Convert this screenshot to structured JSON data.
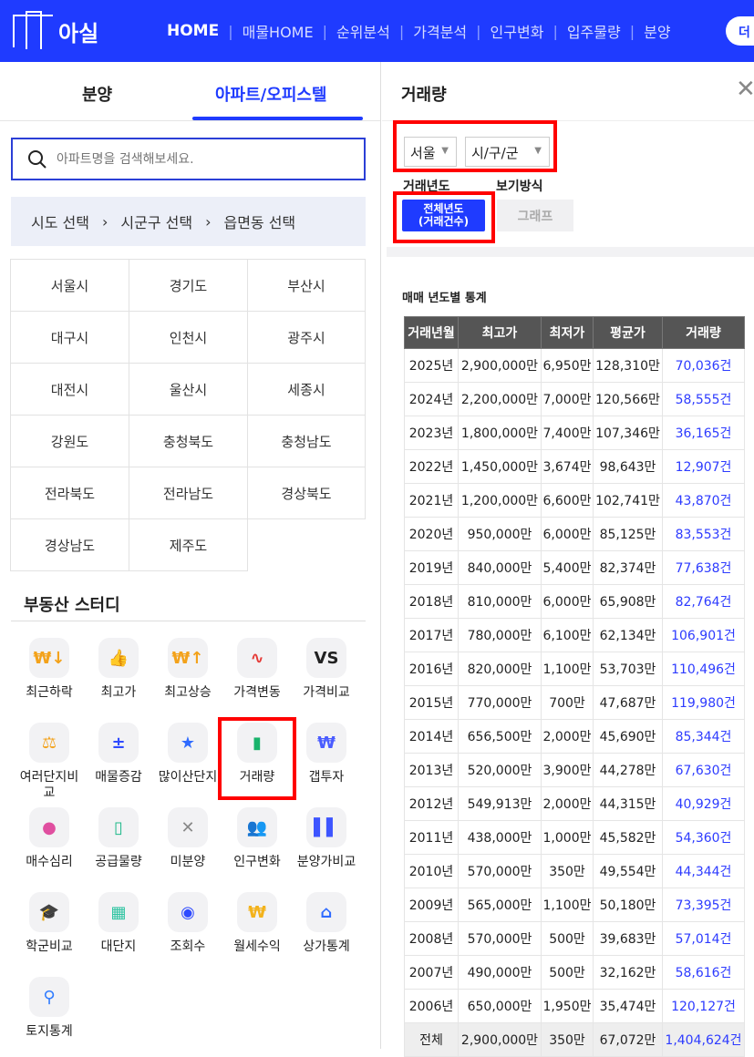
{
  "header": {
    "logo": "아실",
    "nav": [
      "HOME",
      "매물HOME",
      "순위분석",
      "가격분석",
      "인구변화",
      "입주물량",
      "분양"
    ],
    "more": "더"
  },
  "left": {
    "tabs": [
      "분양",
      "아파트/오피스텔"
    ],
    "search_placeholder": "아파트명을 검색해보세요.",
    "breadcrumb": [
      "시도 선택",
      "시군구 선택",
      "읍면동 선택"
    ],
    "regions": [
      "서울시",
      "경기도",
      "부산시",
      "대구시",
      "인천시",
      "광주시",
      "대전시",
      "울산시",
      "세종시",
      "강원도",
      "충청북도",
      "충청남도",
      "전라북도",
      "전라남도",
      "경상북도",
      "경상남도",
      "제주도"
    ],
    "study_title": "부동산 스터디",
    "study": [
      {
        "label": "최근하락",
        "icon": "price-down-icon",
        "glyph": "₩↓",
        "color": "#f3a21b"
      },
      {
        "label": "최고가",
        "icon": "thumbs-up-icon",
        "glyph": "👍",
        "color": "#3d6bff"
      },
      {
        "label": "최고상승",
        "icon": "price-up-icon",
        "glyph": "₩↑",
        "color": "#f3a21b"
      },
      {
        "label": "가격변동",
        "icon": "pulse-icon",
        "glyph": "∿",
        "color": "#e53935"
      },
      {
        "label": "가격비교",
        "icon": "vs-icon",
        "glyph": "VS",
        "color": "#222"
      },
      {
        "label": "여러단지비교",
        "icon": "scale-icon",
        "glyph": "⚖",
        "color": "#f3a21b"
      },
      {
        "label": "매물증감",
        "icon": "plus-minus-icon",
        "glyph": "±",
        "color": "#2f4bff"
      },
      {
        "label": "많이산단지",
        "icon": "map-pin-star-icon",
        "glyph": "★",
        "color": "#2f6bff"
      },
      {
        "label": "거래량",
        "icon": "bar-chart-icon",
        "glyph": "▮",
        "color": "#19b36b"
      },
      {
        "label": "갭투자",
        "icon": "money-bag-hand-icon",
        "glyph": "₩",
        "color": "#4a5cff"
      },
      {
        "label": "매수심리",
        "icon": "brain-icon",
        "glyph": "●",
        "color": "#e04fa0"
      },
      {
        "label": "공급물량",
        "icon": "building-hand-icon",
        "glyph": "▯",
        "color": "#1fb98a"
      },
      {
        "label": "미분양",
        "icon": "document-x-icon",
        "glyph": "✕",
        "color": "#888"
      },
      {
        "label": "인구변화",
        "icon": "people-icon",
        "glyph": "👥",
        "color": "#2f7bff"
      },
      {
        "label": "분양가비교",
        "icon": "bars-compare-icon",
        "glyph": "▌▌",
        "color": "#3d55ff"
      },
      {
        "label": "학군비교",
        "icon": "graduation-cap-icon",
        "glyph": "🎓",
        "color": "#222"
      },
      {
        "label": "대단지",
        "icon": "complex-icon",
        "glyph": "▦",
        "color": "#2cc3a0"
      },
      {
        "label": "조회수",
        "icon": "eye-icon",
        "glyph": "◉",
        "color": "#2f4bff"
      },
      {
        "label": "월세수익",
        "icon": "money-sack-icon",
        "glyph": "₩",
        "color": "#f3b21b"
      },
      {
        "label": "상가통계",
        "icon": "store-icon",
        "glyph": "⌂",
        "color": "#2f6bff"
      },
      {
        "label": "토지통계",
        "icon": "location-pin-icon",
        "glyph": "⚲",
        "color": "#2f7bff"
      }
    ]
  },
  "right": {
    "title": "거래량",
    "city": "서울",
    "district": "시/구/군",
    "year_label": "거래년도",
    "view_label": "보기방식",
    "btn_all_1": "전체년도",
    "btn_all_2": "(거래건수)",
    "btn_graph": "그래프",
    "table_title": "매매 년도별 통계",
    "columns": [
      "거래년월",
      "최고가",
      "최저가",
      "평균가",
      "거래량"
    ],
    "rows": [
      [
        "2025년",
        "2,900,000만",
        "6,950만",
        "128,310만",
        "70,036건"
      ],
      [
        "2024년",
        "2,200,000만",
        "7,000만",
        "120,566만",
        "58,555건"
      ],
      [
        "2023년",
        "1,800,000만",
        "7,400만",
        "107,346만",
        "36,165건"
      ],
      [
        "2022년",
        "1,450,000만",
        "3,674만",
        "98,643만",
        "12,907건"
      ],
      [
        "2021년",
        "1,200,000만",
        "6,600만",
        "102,741만",
        "43,870건"
      ],
      [
        "2020년",
        "950,000만",
        "6,000만",
        "85,125만",
        "83,553건"
      ],
      [
        "2019년",
        "840,000만",
        "5,400만",
        "82,374만",
        "77,638건"
      ],
      [
        "2018년",
        "810,000만",
        "6,000만",
        "65,908만",
        "82,764건"
      ],
      [
        "2017년",
        "780,000만",
        "6,100만",
        "62,134만",
        "106,901건"
      ],
      [
        "2016년",
        "820,000만",
        "1,100만",
        "53,703만",
        "110,496건"
      ],
      [
        "2015년",
        "770,000만",
        "700만",
        "47,687만",
        "119,980건"
      ],
      [
        "2014년",
        "656,500만",
        "2,000만",
        "45,690만",
        "85,344건"
      ],
      [
        "2013년",
        "520,000만",
        "3,900만",
        "44,278만",
        "67,630건"
      ],
      [
        "2012년",
        "549,913만",
        "2,000만",
        "44,315만",
        "40,929건"
      ],
      [
        "2011년",
        "438,000만",
        "1,000만",
        "45,582만",
        "54,360건"
      ],
      [
        "2010년",
        "570,000만",
        "350만",
        "49,554만",
        "44,344건"
      ],
      [
        "2009년",
        "565,000만",
        "1,100만",
        "50,180만",
        "73,395건"
      ],
      [
        "2008년",
        "570,000만",
        "500만",
        "39,683만",
        "57,014건"
      ],
      [
        "2007년",
        "490,000만",
        "500만",
        "32,162만",
        "58,616건"
      ],
      [
        "2006년",
        "650,000만",
        "1,950만",
        "35,474만",
        "120,127건"
      ]
    ],
    "total": [
      "전체",
      "2,900,000만",
      "350만",
      "67,072만",
      "1,404,624건"
    ]
  }
}
